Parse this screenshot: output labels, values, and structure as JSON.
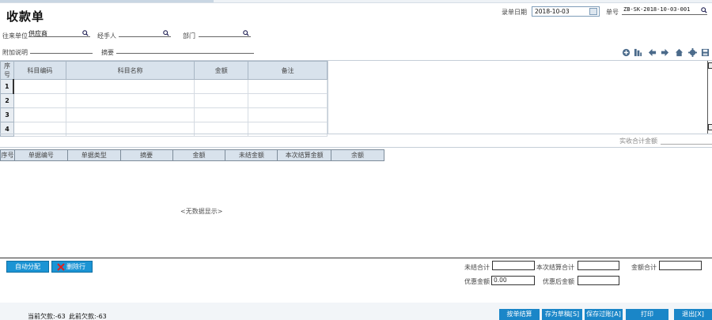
{
  "header": {
    "title": "收款单",
    "entry_date_label": "录单日期",
    "entry_date_value": "2018-10-03",
    "doc_no_label": "单号",
    "doc_no_value": "ZB-SK-2018-10-03-001"
  },
  "form": {
    "partner_label": "往来单位",
    "partner_value": "供应商",
    "handler_label": "经手人",
    "handler_value": "",
    "dept_label": "部门",
    "dept_value": "",
    "note_label": "附加说明",
    "note_value": "",
    "summary_label": "摘要",
    "summary_value": ""
  },
  "toolbar_icons": [
    "add-circle-icon",
    "columns-icon",
    "arrow-left-icon",
    "arrow-right-icon",
    "home-icon",
    "gear-icon",
    "save-icon"
  ],
  "subject_table": {
    "headers": [
      "序号",
      "科目编码",
      "科目名称",
      "金额",
      "备注"
    ],
    "row_numbers": [
      "1",
      "2",
      "3",
      "4"
    ]
  },
  "actual_total_label": "实收合计金额",
  "bill_table": {
    "headers": [
      "序号",
      "单据编号",
      "单据类型",
      "摘要",
      "金额",
      "未结金额",
      "本次结算金额",
      "余额"
    ],
    "empty_text": "<无数据显示>"
  },
  "buttons": {
    "auto_allocate": "自动分配",
    "delete_row": "删除行",
    "settle_by_bill": "按单结算",
    "save_draft": "存为草稿[S]",
    "save_post": "保存过账[A]",
    "print": "打印",
    "exit": "退出[X]"
  },
  "totals": {
    "unsettled_label": "未结合计",
    "current_settle_label": "本次结算合计",
    "amount_total_label": "金额合计",
    "discount_label": "优惠金额",
    "discount_value": "0.00",
    "after_discount_label": "优惠后金额"
  },
  "footer": {
    "current_debt": "当前欠款:-63",
    "previous_debt": "此前欠款:-63"
  },
  "colors": {
    "accent": "#1b94d4",
    "grid_header": "#d8e2ec"
  }
}
